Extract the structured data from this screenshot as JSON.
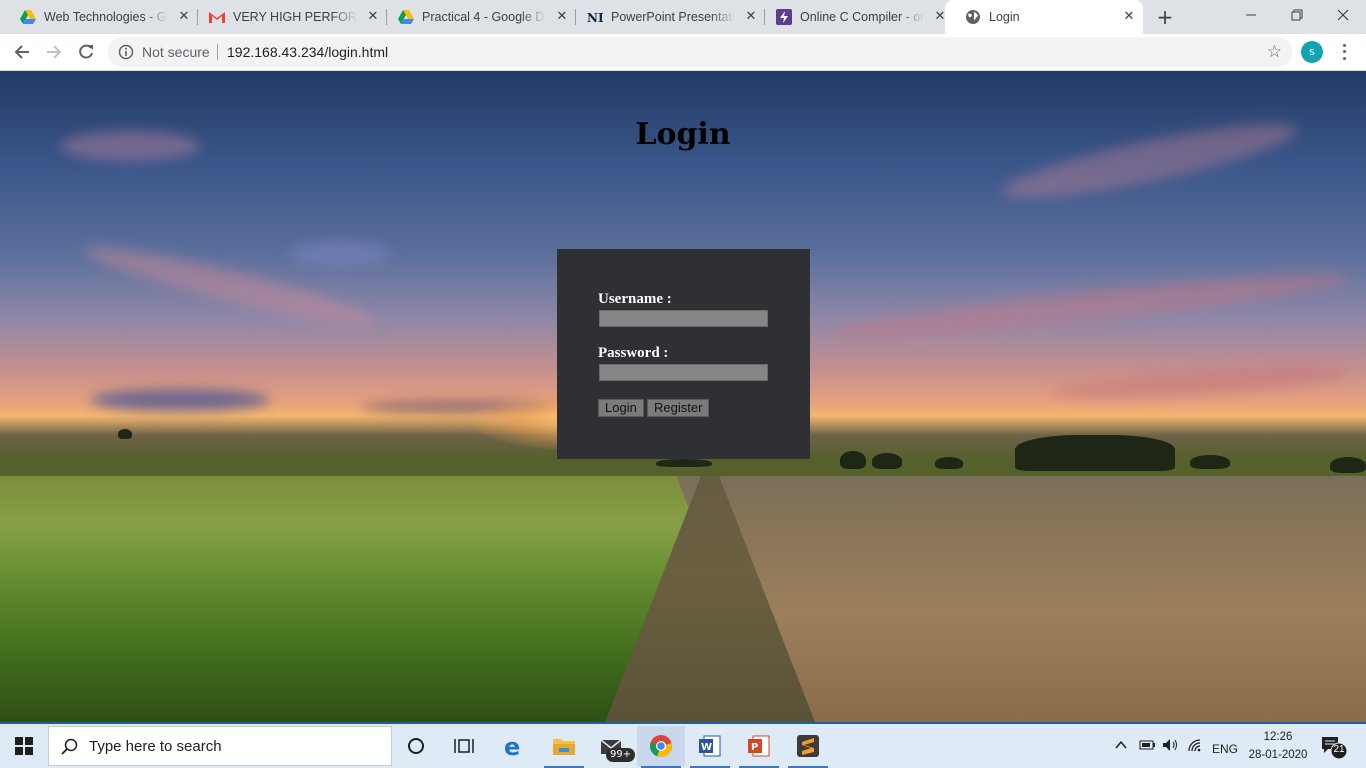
{
  "browser": {
    "tabs": [
      {
        "title": "Web Technologies - Go",
        "favicon": "google-drive-icon"
      },
      {
        "title": "VERY HIGH PERFORMA",
        "favicon": "gmail-icon"
      },
      {
        "title": "Practical 4 - Google Dri",
        "favicon": "google-drive-icon"
      },
      {
        "title": "PowerPoint Presentatio",
        "favicon": "notre-dame-icon"
      },
      {
        "title": "Online C Compiler - onl",
        "favicon": "onlinegdb-icon"
      },
      {
        "title": "Login",
        "favicon": "globe-icon"
      }
    ],
    "new_tab": "+",
    "security_label": "Not secure",
    "url": "192.168.43.234/login.html",
    "profile_initial": "s"
  },
  "page": {
    "heading": "Login",
    "form": {
      "username_label": "Username :",
      "username_value": "",
      "password_label": "Password :",
      "password_value": "",
      "login_button": "Login",
      "register_button": "Register"
    }
  },
  "taskbar": {
    "search_placeholder": "Type here to search",
    "mail_badge": "99+",
    "language": "ENG",
    "time": "12:26",
    "date": "28-01-2020",
    "notification_count": "21"
  }
}
